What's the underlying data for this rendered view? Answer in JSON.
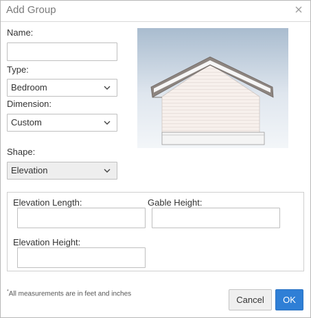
{
  "dialog": {
    "title": "Add Group"
  },
  "icons": {
    "close": "close-icon",
    "dropdown": "chevron-down-icon"
  },
  "form": {
    "name": {
      "label": "Name:",
      "value": ""
    },
    "type": {
      "label": "Type:",
      "value": "Bedroom"
    },
    "dimension": {
      "label": "Dimension:",
      "value": "Custom"
    },
    "shape": {
      "label": "Shape:",
      "value": "Elevation"
    }
  },
  "measurements": {
    "elevation_length": {
      "label": "Elevation Length:",
      "value": ""
    },
    "gable_height": {
      "label": "Gable Height:",
      "value": ""
    },
    "elevation_height": {
      "label": "Elevation Height:",
      "value": ""
    }
  },
  "footer": {
    "note_mark": "*",
    "note": "All measurements are in feet and inches",
    "cancel_label": "Cancel",
    "ok_label": "OK"
  },
  "colors": {
    "ok_button": "#2f7fd6",
    "preview_sky_top": "#aabdd0",
    "preview_wall": "#f7f0ec",
    "preview_roof": "#8c8480"
  }
}
